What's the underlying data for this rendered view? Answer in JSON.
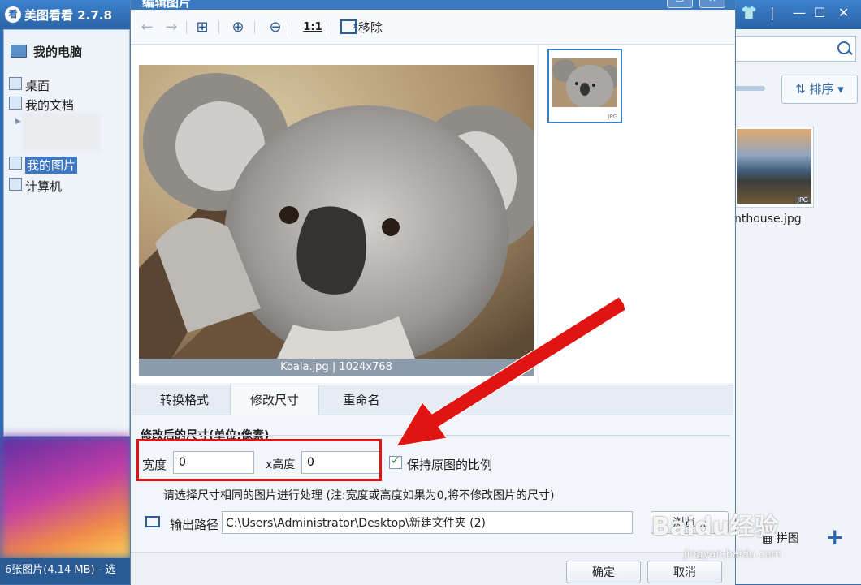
{
  "main_app": {
    "title": "美图看看 2.7.8",
    "logo_glyph": "看",
    "sidebar": {
      "header": "我的电脑",
      "items": [
        {
          "label": "桌面"
        },
        {
          "label": "我的文档"
        },
        {
          "label": "我的图片",
          "selected": true
        },
        {
          "label": "计算机"
        }
      ]
    },
    "status": "6张图片(4.14 MB) - 选",
    "right": {
      "titlebar_icons": [
        "shirt-icon",
        "pin-icon",
        "minimize-icon",
        "maximize-icon",
        "close-icon"
      ],
      "sort_label": "排序",
      "thumb_filename": "nthouse.jpg",
      "thumb_tag": "JPG",
      "bottom_label": "拼图",
      "plus_label": "+"
    }
  },
  "dialog": {
    "title": "编辑图片",
    "toolbar": {
      "remove_label": "移除",
      "ratio_label": "1:1"
    },
    "image_caption": "Koala.jpg | 1024x768",
    "thumb_tag": "JPG",
    "tabs": [
      {
        "label": "转换格式",
        "active": false
      },
      {
        "label": "修改尺寸",
        "active": true
      },
      {
        "label": "重命名",
        "active": false
      }
    ],
    "resize": {
      "section_title": "修改后的尺寸(单位:像素)",
      "width_label": "宽度",
      "width_value": "0",
      "height_label": "x高度",
      "height_value": "0",
      "keep_ratio_label": "保持原图的比例",
      "keep_ratio_checked": true,
      "hint": "请选择尺寸相同的图片进行处理 (注:宽度或高度如果为0,将不修改图片的尺寸)"
    },
    "output": {
      "label": "输出路径",
      "path": "C:\\Users\\Administrator\\Desktop\\新建文件夹 (2)",
      "browse_label": "浏览..."
    },
    "ok_label": "确定",
    "cancel_label": "取消"
  },
  "overlay": {
    "watermark": "Baidu经验",
    "watermark_sub": "jingyan.baidu.com",
    "highlight_color": "#e11414",
    "arrow_color": "#e11414"
  }
}
